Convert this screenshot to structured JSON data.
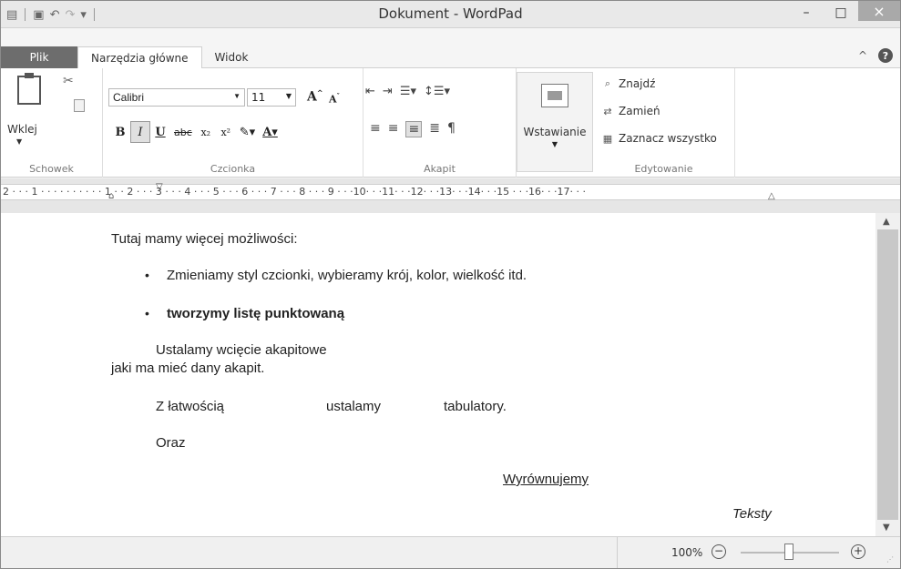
{
  "window": {
    "title": "Dokument - WordPad",
    "minimize": "–",
    "maximize": "□",
    "close": "×"
  },
  "tabs": [
    {
      "label": "Plik"
    },
    {
      "label": "Narzędzia główne"
    },
    {
      "label": "Widok"
    }
  ],
  "ribbon": {
    "clipboard": {
      "group_label": "Schowek",
      "paste_label": "Wklej"
    },
    "font": {
      "group_label": "Czcionka",
      "font_name": "Calibri",
      "font_size": "11"
    },
    "paragraph": {
      "group_label": "Akapit"
    },
    "insert": {
      "label": "Wstawianie"
    },
    "editing": {
      "group_label": "Edytowanie",
      "find": "Znajdź",
      "replace": "Zamień",
      "select_all": "Zaznacz wszystko"
    }
  },
  "ruler": {
    "text": "2 · · · 1 · · · ·  · · · ·  · · 1 · · 2 · · · 3 · · · 4 · · · 5 · · · 6 · · · 7 · · · 8 · · · 9 · · ·10· · ·11· · ·12· · ·13· · ·14· · ·15 · · ·16· · ·17· · ·"
  },
  "document": {
    "p1": "Tutaj mamy więcej możliwości:",
    "bullet1": "Zmieniamy styl czcionki, wybieramy krój, kolor, wielkość itd.",
    "bullet2": "tworzymy listę punktowaną",
    "p2a": "Ustalamy wcięcie akapitowe",
    "p2b": "jaki ma mieć dany akapit.",
    "tab1": "Z łatwością",
    "tab2": "ustalamy",
    "tab3": "tabulatory.",
    "p4": "Oraz",
    "p5": "Wyrównujemy",
    "p6": "Teksty"
  },
  "status": {
    "zoom": "100%"
  }
}
